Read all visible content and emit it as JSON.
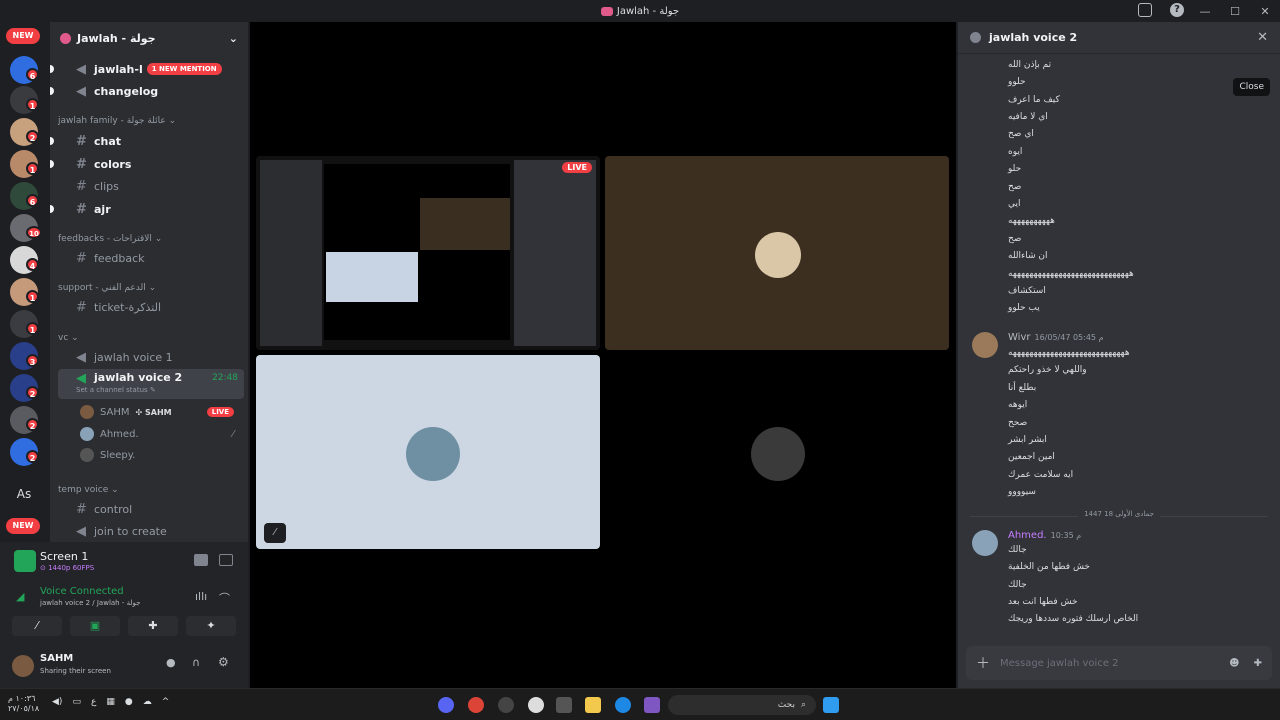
{
  "window": {
    "title": "Jawlah - جولة"
  },
  "server": {
    "name": "Jawlah - جولة"
  },
  "rail": {
    "new_label": "NEW",
    "as_label": "As",
    "badges": [
      "6",
      "1",
      "2",
      "1",
      "6",
      "10",
      "4",
      "1",
      "1",
      "3",
      "2",
      "2",
      "2"
    ]
  },
  "channels": {
    "top": [
      {
        "name": "jawlah-l",
        "mention": "1 NEW MENTION",
        "unread": true
      },
      {
        "name": "changelog",
        "unread": true
      }
    ],
    "categories": [
      {
        "label": "jawlah family - عائلة جولة ⌄"
      },
      {
        "label": "feedbacks - الاقتراحات ⌄"
      },
      {
        "label": "support - الدعم الفني ⌄"
      },
      {
        "label": "vc ⌄"
      },
      {
        "label": "temp voice ⌄"
      }
    ],
    "chat": "chat",
    "colors": "colors",
    "clips": "clips",
    "ajr": "ajr",
    "feedback": "feedback",
    "ticket": "ticket-التذكرة",
    "voice1": "jawlah voice 1",
    "voice2": "jawlah voice 2",
    "voice2_time": "22:48",
    "voice2_status": "Set a channel status ✎",
    "control": "control",
    "join": "join to create",
    "vc_users": [
      {
        "name": "SAHM",
        "tag": "✣ SAHM",
        "live": "LIVE"
      },
      {
        "name": "Ahmed."
      },
      {
        "name": "Sleepy."
      }
    ]
  },
  "panel": {
    "screen_title": "Screen 1",
    "screen_quality": "⊙ 1440p 60FPS",
    "voice_connected": "Voice Connected",
    "voice_location": "jawlah voice 2 / Jawlah - جولة",
    "user_name": "SAHM",
    "user_status": "Sharing their screen"
  },
  "stage": {
    "live_label": "LIVE"
  },
  "chat": {
    "title": "jawlah voice 2",
    "close_tooltip": "Close",
    "placeholder": "Message jawlah voice 2",
    "lines_a": [
      "تم بإذن الله",
      "حلوو",
      "كيف ما اعرف",
      "اي لا مافيه",
      "اي صح",
      "ايوه",
      "حلو",
      "صح",
      "ايي",
      "ههههههههههه",
      "صح",
      "ان شاءالله",
      "هههههههههههههههههههههههههههههه",
      "استكشاف",
      "يب حلوو"
    ],
    "wivr": {
      "name": "Wivr",
      "time": "16/05/47 05:45 م"
    },
    "lines_b": [
      "ههههههههههههههههههههههههههههه",
      "واللهي لا خذو راحتكم",
      "بطلع أنا",
      "ايوهه",
      "صحح",
      "ابشر ابشر",
      "امين اجمعين",
      "ايه سلامت عمرك",
      "سيوووو"
    ],
    "day_divider": "جمادى الأولى 18 1447",
    "ahmed": {
      "name": "Ahmed.",
      "time": "10:35 م"
    },
    "lines_c": [
      "جالك",
      "خش فطها من الخلفية",
      "جالك",
      "خش فطها انت بعد",
      "الخاص ارسلك فتوره سددها وريجك"
    ]
  },
  "taskbar": {
    "search": "بحث",
    "time": "١٠:٣٦ م",
    "date": "٢٧/٠٥/١٨"
  },
  "colors": {
    "accent": "#5865f2",
    "green": "#23a559",
    "red": "#f23f43"
  }
}
